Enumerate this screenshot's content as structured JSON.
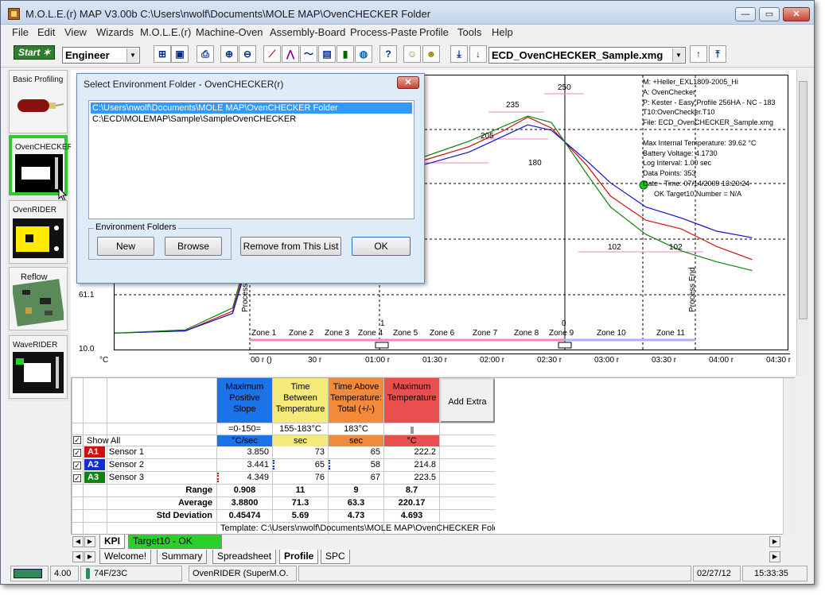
{
  "titlebar": {
    "title": "M.O.L.E.(r) MAP V3.00b  C:\\Users\\nwolf\\Documents\\MOLE MAP\\OvenCHECKER Folder",
    "minimize": "—",
    "maximize": "▭",
    "close": "✕"
  },
  "menu": [
    "File",
    "Edit",
    "View",
    "Wizards",
    "M.O.L.E.(r)",
    "Machine-Oven",
    "Assembly-Board",
    "Process-Paste",
    "Profile",
    "Tools",
    "Help"
  ],
  "toolbar": {
    "start_label": "Start",
    "role_value": "Engineer",
    "file_value": "ECD_OvenCHECKER_Sample.xmg"
  },
  "sidebar": {
    "items": [
      {
        "label": "Basic Profiling"
      },
      {
        "label": "OvenCHECKER"
      },
      {
        "label": "OvenRIDER"
      },
      {
        "label": "Reflow"
      },
      {
        "label": "WaveRIDER"
      }
    ]
  },
  "dialog": {
    "title": "Select Environment Folder - OvenCHECKER(r)",
    "close": "✕",
    "folders": [
      "C:\\Users\\nwolf\\Documents\\MOLE MAP\\OvenCHECKER Folder",
      "C:\\ECD\\MOLEMAP\\Sample\\SampleOvenCHECKER"
    ],
    "group_label": "Environment Folders",
    "new_label": "New",
    "browse_label": "Browse",
    "remove_label": "Remove from This List",
    "ok_label": "OK"
  },
  "chart": {
    "y_ticks": [
      "61.1",
      "10.0",
      "°C"
    ],
    "x_ticks": [
      "00 r ()",
      "30 r",
      "01:00 r",
      "01:30 r",
      "02:00 r",
      "02:30 r",
      "03:00 r",
      "03:30 r",
      "04:00 r",
      "04:30 r"
    ],
    "info": [
      "M: +Heller_EXL1809-2005_Hi",
      "A: OvenChecker",
      "P: Kester - Easy Profile 256HA - NC - 183",
      "T10:OvenChecker.T10",
      "File: ECD_OvenCHECKER_Sample.xmg",
      "",
      "Max Internal Temperature:  39.62 °C",
      "Battery Voltage: 4.1730",
      "Log Interval: 1.00 sec",
      "Data Points: 353",
      "Date - Time: 07/14/2009 13:20:24",
      "OK Target10 Number = N/A"
    ],
    "zones": [
      "Zone 1",
      "Zone 2",
      "Zone 3",
      "Zone 4",
      "Zone 5",
      "Zone 6",
      "Zone 7",
      "Zone 8",
      "Zone 9",
      "Zone 10",
      "Zone 11"
    ],
    "setpoints": [
      "180",
      "205",
      "235",
      "250",
      "102",
      "102"
    ],
    "markers": [
      "Process",
      "Process End",
      "1",
      "0"
    ],
    "colors": {
      "sensor1": "#d01010",
      "sensor2": "#1010d0",
      "sensor3": "#108010"
    }
  },
  "chart_data": {
    "type": "line",
    "title": "",
    "xlabel": "",
    "ylabel": "°C",
    "x_ticks": [
      "00 r ()",
      "30 r",
      "01:00 r",
      "01:30 r",
      "02:00 r",
      "02:30 r",
      "03:00 r",
      "03:30 r",
      "04:00 r",
      "04:30 r"
    ],
    "ylim": [
      10.0,
      260
    ],
    "series": [
      {
        "name": "Sensor 1",
        "x": [
          0,
          30,
          50,
          60,
          75,
          90,
          110,
          130,
          150,
          165,
          175,
          185,
          200,
          210,
          225,
          240,
          255,
          270
        ],
        "y": [
          25,
          27,
          45,
          120,
          165,
          175,
          178,
          182,
          195,
          210,
          222,
          212,
          178,
          150,
          128,
          120,
          104,
          92
        ]
      },
      {
        "name": "Sensor 2",
        "x": [
          0,
          30,
          50,
          60,
          75,
          90,
          110,
          130,
          150,
          165,
          175,
          185,
          200,
          210,
          225,
          240,
          255,
          270
        ],
        "y": [
          25,
          27,
          43,
          115,
          160,
          172,
          175,
          178,
          190,
          205,
          215,
          210,
          182,
          162,
          140,
          130,
          118,
          112
        ]
      },
      {
        "name": "Sensor 3",
        "x": [
          0,
          30,
          50,
          60,
          75,
          90,
          110,
          130,
          150,
          165,
          175,
          185,
          200,
          210,
          225,
          240,
          255,
          270
        ],
        "y": [
          25,
          28,
          48,
          125,
          168,
          176,
          180,
          185,
          200,
          214,
          223,
          217,
          170,
          140,
          115,
          100,
          90,
          82
        ]
      }
    ]
  },
  "table": {
    "columns": [
      {
        "title": "Maximum Positive Slope",
        "spec": "=0-150=",
        "unit": "°C/sec",
        "color": "#1a73e8"
      },
      {
        "title": "Time Between Temperature",
        "spec": "155-183°C",
        "unit": "sec",
        "color": "#f5e97a"
      },
      {
        "title": "Time Above Temperature: Total (+/-)",
        "spec": "183°C",
        "unit": "sec",
        "color": "#f28a3c"
      },
      {
        "title": "Maximum Temperature",
        "spec": "",
        "unit": "°C",
        "color": "#ea4f4f"
      }
    ],
    "add_extra": "Add Extra",
    "show_all": "Show All",
    "sensors": [
      {
        "tag": "A1",
        "name": "Sensor 1",
        "values": [
          "3.850",
          "73",
          "65",
          "222.2"
        ],
        "color": "#cc1010"
      },
      {
        "tag": "A2",
        "name": "Sensor 2",
        "values": [
          "3.441",
          "65",
          "58",
          "214.8"
        ],
        "color": "#1030cc"
      },
      {
        "tag": "A3",
        "name": "Sensor 3",
        "values": [
          "4.349",
          "76",
          "67",
          "223.5"
        ],
        "color": "#128012"
      }
    ],
    "stats": [
      {
        "label": "Range",
        "values": [
          "0.908",
          "11",
          "9",
          "8.7"
        ]
      },
      {
        "label": "Average",
        "values": [
          "3.8800",
          "71.3",
          "63.3",
          "220.17"
        ]
      },
      {
        "label": "Std Deviation",
        "values": [
          "0.45474",
          "5.69",
          "4.73",
          "4.693"
        ]
      }
    ],
    "template": "Template: C:\\Users\\nwolf\\Documents\\MOLE MAP\\OvenCHECKER Folder"
  },
  "inner_tabs": [
    "KPI",
    "Target10 - OK"
  ],
  "view_tabs": [
    "Welcome!",
    "Summary",
    "Spreadsheet",
    "Profile",
    "SPC"
  ],
  "status": {
    "battery": "4.00",
    "temp": "74F/23C",
    "device": "OvenRIDER (SuperM.O.",
    "date": "02/27/12",
    "time": "15:33:35"
  }
}
